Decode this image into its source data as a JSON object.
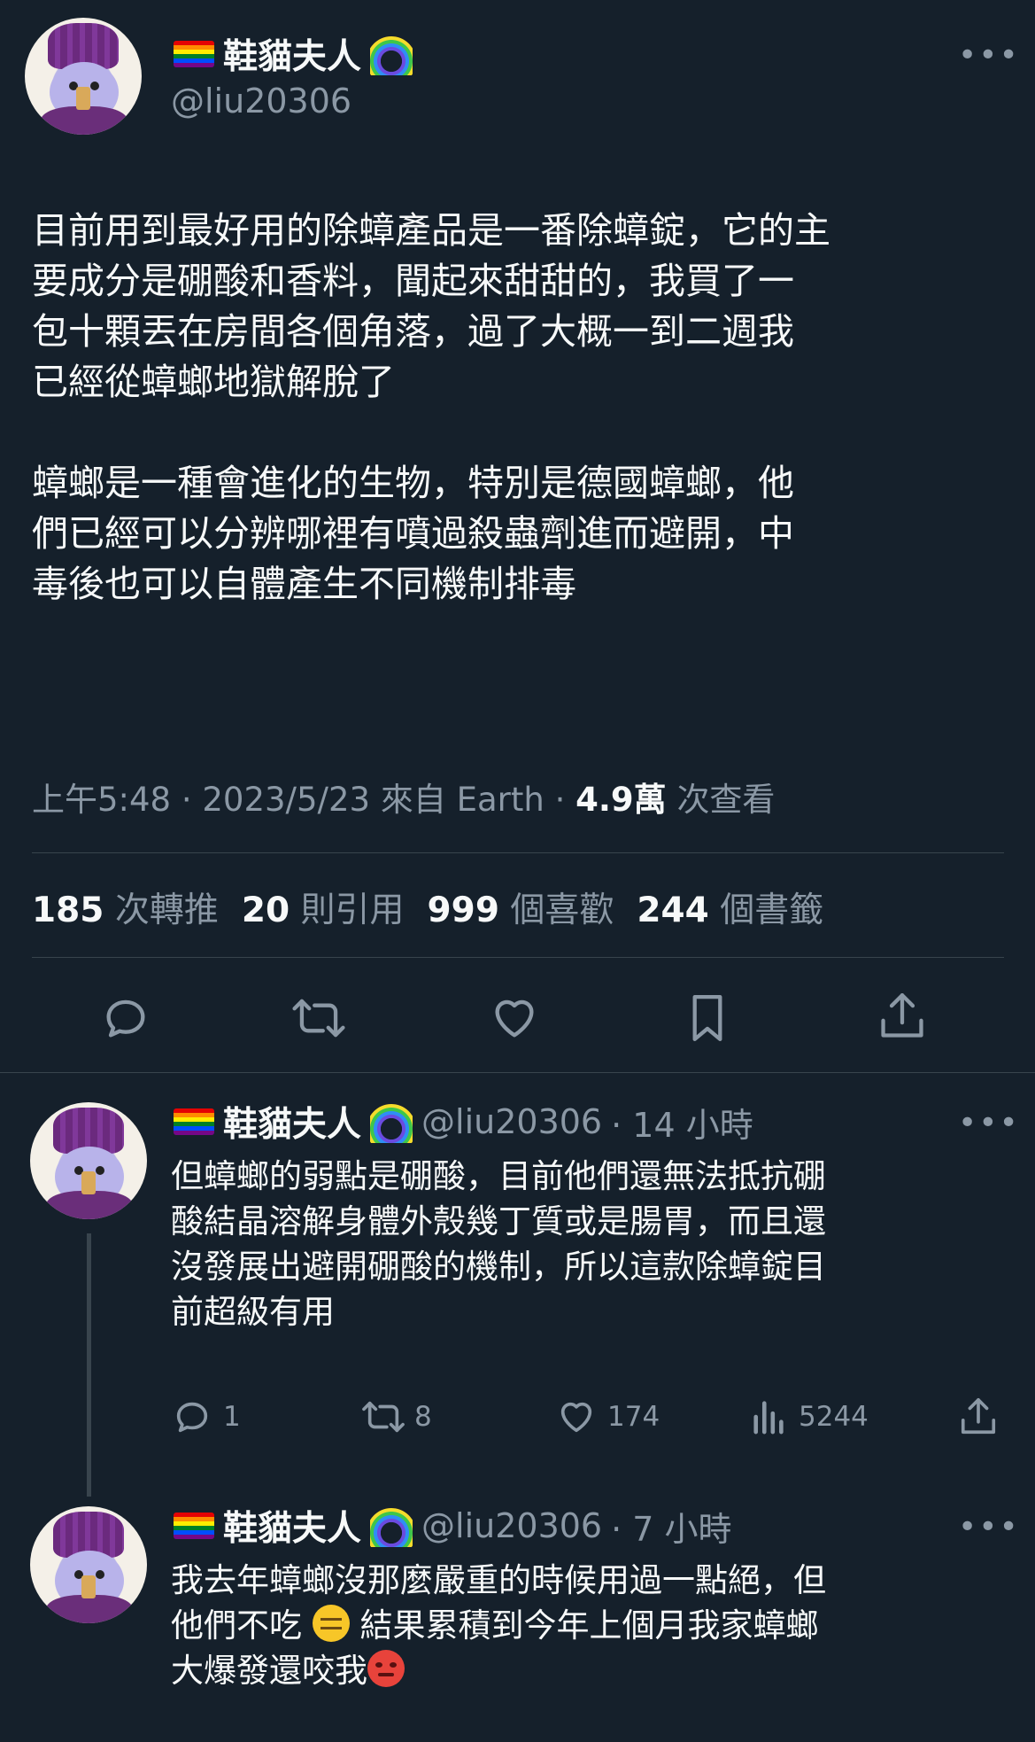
{
  "main_tweet": {
    "author_name": "鞋貓夫人",
    "handle": "@liu20306",
    "more": "•••",
    "text": "目前用到最好用的除蟑產品是一番除蟑錠，它的主\n要成分是硼酸和香料，聞起來甜甜的，我買了一\n包十顆丟在房間各個角落，過了大概一到二週我\n已經從蟑螂地獄解脫了\n\n蟑螂是一種會進化的生物，特別是德國蟑螂，他\n們已經可以分辨哪裡有噴過殺蟲劑進而避開，中\n毒後也可以自體產生不同機制排毒",
    "meta_prefix": "上午5:48 · 2023/5/23 來自 Earth · ",
    "views_num": "4.9萬",
    "views_label": "次查看",
    "stats": [
      {
        "num": "185",
        "label": "次轉推"
      },
      {
        "num": "20",
        "label": "則引用"
      },
      {
        "num": "999",
        "label": "個喜歡"
      },
      {
        "num": "244",
        "label": "個書籤"
      }
    ],
    "actions": [
      "reply-icon",
      "retweet-icon",
      "like-icon",
      "bookmark-icon",
      "share-icon"
    ]
  },
  "replies": [
    {
      "author_name": "鞋貓夫人",
      "handle": "@liu20306",
      "time": "· 14 小時",
      "more": "•••",
      "text": "但蟑螂的弱點是硼酸，目前他們還無法抵抗硼\n酸結晶溶解身體外殼幾丁質或是腸胃，而且還\n沒發展出避開硼酸的機制，所以這款除蟑錠目\n前超級有用",
      "reply_count": "1",
      "retweet_count": "8",
      "like_count": "174",
      "view_count": "5244"
    },
    {
      "author_name": "鞋貓夫人",
      "handle": "@liu20306",
      "time": "· 7 小時",
      "more": "•••",
      "text_line1": "我去年蟑螂沒那麼嚴重的時候用過一點絕，但",
      "text_line2a": "他們不吃",
      "text_line2b": "結果累積到今年上個月我家蟑螂",
      "text_line3": "大爆發還咬我"
    }
  ]
}
